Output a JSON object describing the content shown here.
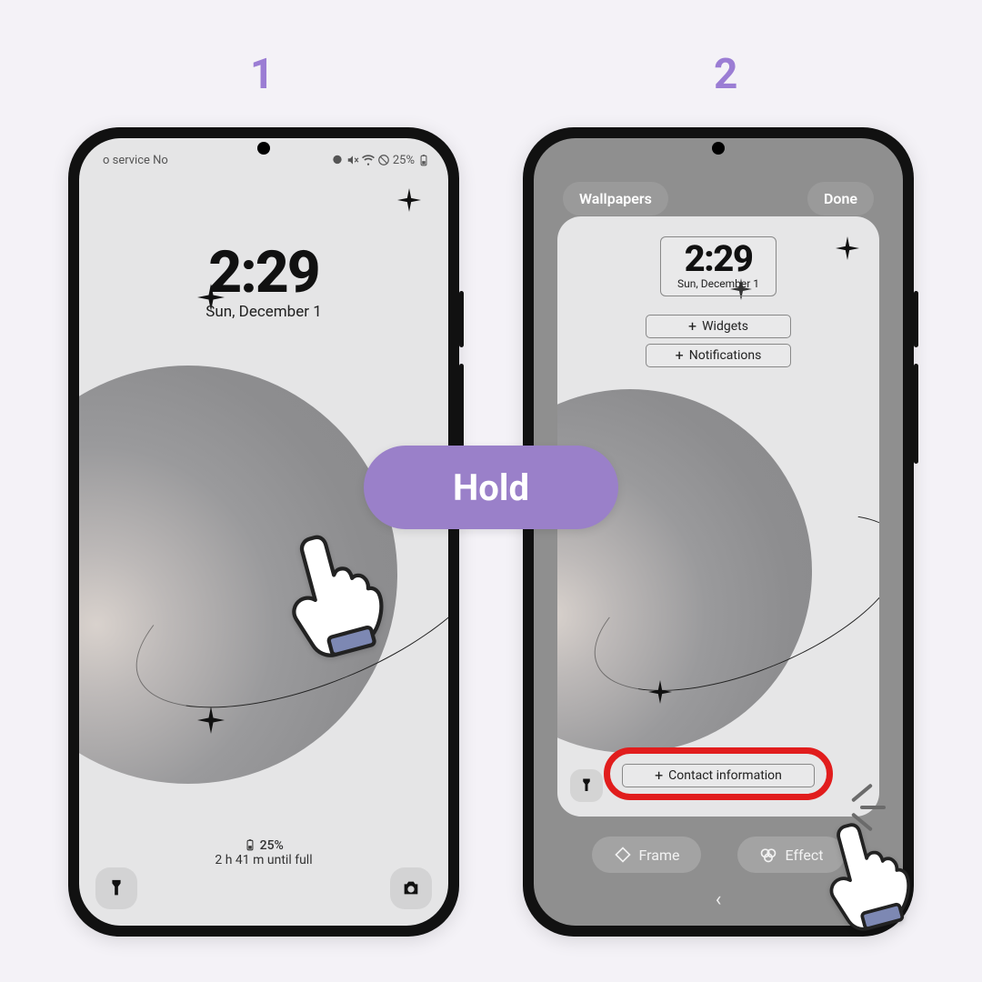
{
  "steps": {
    "one": "1",
    "two": "2"
  },
  "phone1": {
    "status": {
      "carrier": "o service    No",
      "battery_pct": "25%"
    },
    "clock": {
      "time": "2:29",
      "date": "Sun, December 1"
    },
    "footer": {
      "pct": "25%",
      "remaining": "2 h 41 m until full"
    },
    "overlay_label": "Hold"
  },
  "phone2": {
    "top_buttons": {
      "wallpapers": "Wallpapers",
      "done": "Done"
    },
    "clock": {
      "time": "2:29",
      "date": "Sun, December 1"
    },
    "add": {
      "widgets": "Widgets",
      "notifications": "Notifications",
      "contact": "Contact information"
    },
    "toolbar": {
      "frame": "Frame",
      "effect": "Effect"
    }
  },
  "icons": {
    "plus": "+",
    "back": "‹",
    "battery_glyph": "▮"
  }
}
